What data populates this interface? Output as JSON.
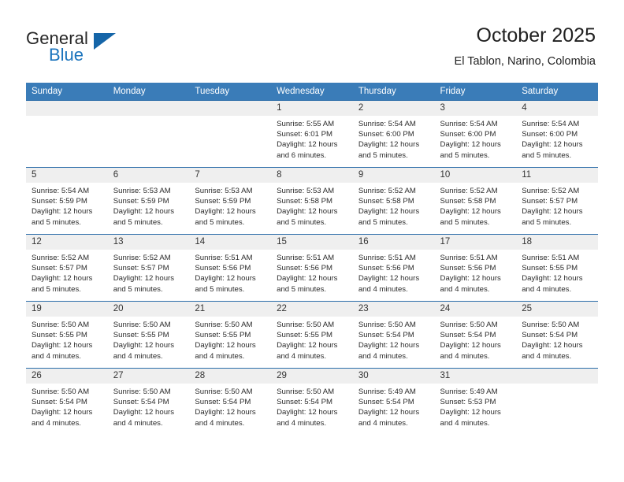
{
  "brand": {
    "name_top": "General",
    "name_bottom": "Blue",
    "color_primary": "#1b74bd",
    "color_triangle": "#1565a8"
  },
  "header": {
    "title": "October 2025",
    "subtitle": "El Tablon, Narino, Colombia"
  },
  "calendar": {
    "header_bg": "#3a7cb8",
    "daynum_bg": "#efefef",
    "row_border": "#2a6ca8",
    "weekday_headers": [
      "Sunday",
      "Monday",
      "Tuesday",
      "Wednesday",
      "Thursday",
      "Friday",
      "Saturday"
    ],
    "weeks": [
      [
        {
          "day": "",
          "blank": true
        },
        {
          "day": "",
          "blank": true
        },
        {
          "day": "",
          "blank": true
        },
        {
          "day": "1",
          "sunrise": "Sunrise: 5:55 AM",
          "sunset": "Sunset: 6:01 PM",
          "daylight": "Daylight: 12 hours and 6 minutes."
        },
        {
          "day": "2",
          "sunrise": "Sunrise: 5:54 AM",
          "sunset": "Sunset: 6:00 PM",
          "daylight": "Daylight: 12 hours and 5 minutes."
        },
        {
          "day": "3",
          "sunrise": "Sunrise: 5:54 AM",
          "sunset": "Sunset: 6:00 PM",
          "daylight": "Daylight: 12 hours and 5 minutes."
        },
        {
          "day": "4",
          "sunrise": "Sunrise: 5:54 AM",
          "sunset": "Sunset: 6:00 PM",
          "daylight": "Daylight: 12 hours and 5 minutes."
        }
      ],
      [
        {
          "day": "5",
          "sunrise": "Sunrise: 5:54 AM",
          "sunset": "Sunset: 5:59 PM",
          "daylight": "Daylight: 12 hours and 5 minutes."
        },
        {
          "day": "6",
          "sunrise": "Sunrise: 5:53 AM",
          "sunset": "Sunset: 5:59 PM",
          "daylight": "Daylight: 12 hours and 5 minutes."
        },
        {
          "day": "7",
          "sunrise": "Sunrise: 5:53 AM",
          "sunset": "Sunset: 5:59 PM",
          "daylight": "Daylight: 12 hours and 5 minutes."
        },
        {
          "day": "8",
          "sunrise": "Sunrise: 5:53 AM",
          "sunset": "Sunset: 5:58 PM",
          "daylight": "Daylight: 12 hours and 5 minutes."
        },
        {
          "day": "9",
          "sunrise": "Sunrise: 5:52 AM",
          "sunset": "Sunset: 5:58 PM",
          "daylight": "Daylight: 12 hours and 5 minutes."
        },
        {
          "day": "10",
          "sunrise": "Sunrise: 5:52 AM",
          "sunset": "Sunset: 5:58 PM",
          "daylight": "Daylight: 12 hours and 5 minutes."
        },
        {
          "day": "11",
          "sunrise": "Sunrise: 5:52 AM",
          "sunset": "Sunset: 5:57 PM",
          "daylight": "Daylight: 12 hours and 5 minutes."
        }
      ],
      [
        {
          "day": "12",
          "sunrise": "Sunrise: 5:52 AM",
          "sunset": "Sunset: 5:57 PM",
          "daylight": "Daylight: 12 hours and 5 minutes."
        },
        {
          "day": "13",
          "sunrise": "Sunrise: 5:52 AM",
          "sunset": "Sunset: 5:57 PM",
          "daylight": "Daylight: 12 hours and 5 minutes."
        },
        {
          "day": "14",
          "sunrise": "Sunrise: 5:51 AM",
          "sunset": "Sunset: 5:56 PM",
          "daylight": "Daylight: 12 hours and 5 minutes."
        },
        {
          "day": "15",
          "sunrise": "Sunrise: 5:51 AM",
          "sunset": "Sunset: 5:56 PM",
          "daylight": "Daylight: 12 hours and 5 minutes."
        },
        {
          "day": "16",
          "sunrise": "Sunrise: 5:51 AM",
          "sunset": "Sunset: 5:56 PM",
          "daylight": "Daylight: 12 hours and 4 minutes."
        },
        {
          "day": "17",
          "sunrise": "Sunrise: 5:51 AM",
          "sunset": "Sunset: 5:56 PM",
          "daylight": "Daylight: 12 hours and 4 minutes."
        },
        {
          "day": "18",
          "sunrise": "Sunrise: 5:51 AM",
          "sunset": "Sunset: 5:55 PM",
          "daylight": "Daylight: 12 hours and 4 minutes."
        }
      ],
      [
        {
          "day": "19",
          "sunrise": "Sunrise: 5:50 AM",
          "sunset": "Sunset: 5:55 PM",
          "daylight": "Daylight: 12 hours and 4 minutes."
        },
        {
          "day": "20",
          "sunrise": "Sunrise: 5:50 AM",
          "sunset": "Sunset: 5:55 PM",
          "daylight": "Daylight: 12 hours and 4 minutes."
        },
        {
          "day": "21",
          "sunrise": "Sunrise: 5:50 AM",
          "sunset": "Sunset: 5:55 PM",
          "daylight": "Daylight: 12 hours and 4 minutes."
        },
        {
          "day": "22",
          "sunrise": "Sunrise: 5:50 AM",
          "sunset": "Sunset: 5:55 PM",
          "daylight": "Daylight: 12 hours and 4 minutes."
        },
        {
          "day": "23",
          "sunrise": "Sunrise: 5:50 AM",
          "sunset": "Sunset: 5:54 PM",
          "daylight": "Daylight: 12 hours and 4 minutes."
        },
        {
          "day": "24",
          "sunrise": "Sunrise: 5:50 AM",
          "sunset": "Sunset: 5:54 PM",
          "daylight": "Daylight: 12 hours and 4 minutes."
        },
        {
          "day": "25",
          "sunrise": "Sunrise: 5:50 AM",
          "sunset": "Sunset: 5:54 PM",
          "daylight": "Daylight: 12 hours and 4 minutes."
        }
      ],
      [
        {
          "day": "26",
          "sunrise": "Sunrise: 5:50 AM",
          "sunset": "Sunset: 5:54 PM",
          "daylight": "Daylight: 12 hours and 4 minutes."
        },
        {
          "day": "27",
          "sunrise": "Sunrise: 5:50 AM",
          "sunset": "Sunset: 5:54 PM",
          "daylight": "Daylight: 12 hours and 4 minutes."
        },
        {
          "day": "28",
          "sunrise": "Sunrise: 5:50 AM",
          "sunset": "Sunset: 5:54 PM",
          "daylight": "Daylight: 12 hours and 4 minutes."
        },
        {
          "day": "29",
          "sunrise": "Sunrise: 5:50 AM",
          "sunset": "Sunset: 5:54 PM",
          "daylight": "Daylight: 12 hours and 4 minutes."
        },
        {
          "day": "30",
          "sunrise": "Sunrise: 5:49 AM",
          "sunset": "Sunset: 5:54 PM",
          "daylight": "Daylight: 12 hours and 4 minutes."
        },
        {
          "day": "31",
          "sunrise": "Sunrise: 5:49 AM",
          "sunset": "Sunset: 5:53 PM",
          "daylight": "Daylight: 12 hours and 4 minutes."
        },
        {
          "day": "",
          "blank": true
        }
      ]
    ]
  }
}
